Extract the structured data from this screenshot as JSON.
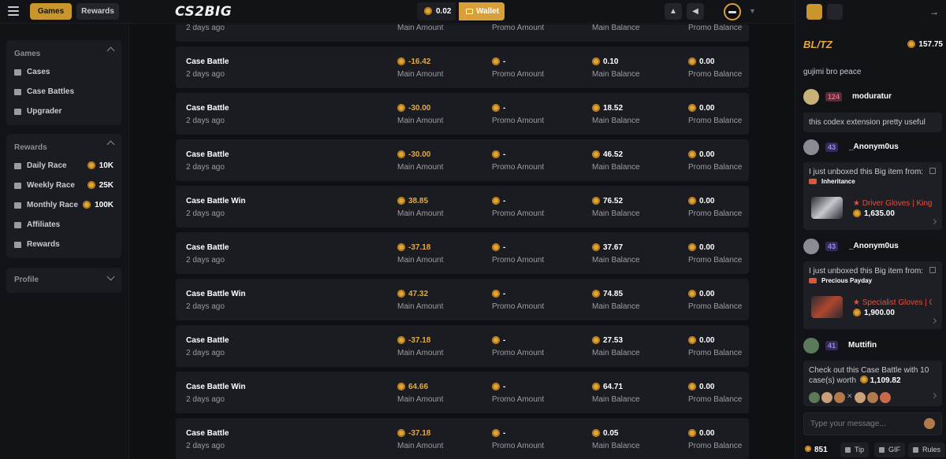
{
  "header": {
    "nav_games": "Games",
    "nav_rewards": "Rewards",
    "logo": "CS2BIG",
    "balance": "0.02",
    "wallet_label": "Wallet"
  },
  "sidebar": {
    "games_heading": "Games",
    "games_items": [
      "Cases",
      "Case Battles",
      "Upgrader"
    ],
    "rewards_heading": "Rewards",
    "races": [
      {
        "label": "Daily Race",
        "value": "10K"
      },
      {
        "label": "Weekly Race",
        "value": "25K"
      },
      {
        "label": "Monthly Race",
        "value": "100K"
      }
    ],
    "rewards_items": [
      "Affiliates",
      "Rewards"
    ],
    "profile_heading": "Profile"
  },
  "transactions": {
    "labels": {
      "main_amount": "Main Amount",
      "promo_amount": "Promo Amount",
      "main_balance": "Main Balance",
      "promo_balance": "Promo Balance"
    },
    "rows": [
      {
        "title": "",
        "time": "2 days ago",
        "main_amount": "",
        "promo_amount": "",
        "main_balance": "",
        "promo_balance": ""
      },
      {
        "title": "Case Battle",
        "time": "2 days ago",
        "main_amount": "-16.42",
        "promo_amount": "-",
        "main_balance": "0.10",
        "promo_balance": "0.00"
      },
      {
        "title": "Case Battle",
        "time": "2 days ago",
        "main_amount": "-30.00",
        "promo_amount": "-",
        "main_balance": "18.52",
        "promo_balance": "0.00"
      },
      {
        "title": "Case Battle",
        "time": "2 days ago",
        "main_amount": "-30.00",
        "promo_amount": "-",
        "main_balance": "46.52",
        "promo_balance": "0.00"
      },
      {
        "title": "Case Battle Win",
        "time": "2 days ago",
        "main_amount": "38.85",
        "promo_amount": "-",
        "main_balance": "76.52",
        "promo_balance": "0.00"
      },
      {
        "title": "Case Battle",
        "time": "2 days ago",
        "main_amount": "-37.18",
        "promo_amount": "-",
        "main_balance": "37.67",
        "promo_balance": "0.00"
      },
      {
        "title": "Case Battle Win",
        "time": "2 days ago",
        "main_amount": "47.32",
        "promo_amount": "-",
        "main_balance": "74.85",
        "promo_balance": "0.00"
      },
      {
        "title": "Case Battle",
        "time": "2 days ago",
        "main_amount": "-37.18",
        "promo_amount": "-",
        "main_balance": "27.53",
        "promo_balance": "0.00"
      },
      {
        "title": "Case Battle Win",
        "time": "2 days ago",
        "main_amount": "64.66",
        "promo_amount": "-",
        "main_balance": "64.71",
        "promo_balance": "0.00"
      },
      {
        "title": "Case Battle",
        "time": "2 days ago",
        "main_amount": "-37.18",
        "promo_amount": "-",
        "main_balance": "0.05",
        "promo_balance": "0.00"
      }
    ]
  },
  "chat": {
    "blitz_label": "BL/TZ",
    "blitz_value": "157.75",
    "first_message": "gujimi bro peace",
    "messages": [
      {
        "level": "124",
        "user": "moduratur",
        "text": "this codex extension pretty useful"
      },
      {
        "level": "43",
        "user": "_Anonym0us",
        "text": "I just unboxed this Big item from:",
        "box": "Inheritance",
        "item": "★ Driver Gloves | King Snake",
        "price": "1,635.00"
      },
      {
        "level": "43",
        "user": "_Anonym0us",
        "text": "I just unboxed this Big item from:",
        "box": "Precious Payday",
        "item": "★ Specialist Gloves | Crimson Kimono",
        "price": "1,900.00"
      },
      {
        "level": "41",
        "user": "Muttifin",
        "text_line1": "Check out this Case Battle with 10",
        "text_line2": "case(s) worth",
        "price": "1,109.82"
      }
    ],
    "input_placeholder": "Type your message...",
    "online_count": "851",
    "tip_label": "Tip",
    "gif_label": "GIF",
    "rules_label": "Rules"
  },
  "colors": {
    "accent": "#d9a03a",
    "negative_amount": "#e3a944",
    "item_name": "#e84e3c"
  }
}
